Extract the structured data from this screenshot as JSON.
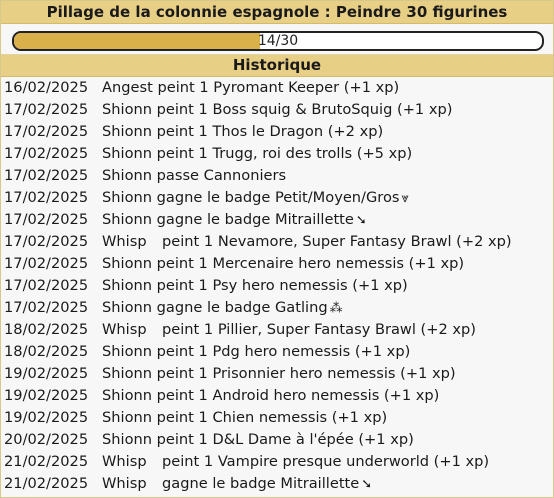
{
  "challenge": {
    "title": "Pillage de la colonnie espagnole : Peindre 30 figurines",
    "progress_text": "14/30",
    "progress_value": 14,
    "progress_total": 30,
    "accent_color": "#dab04a"
  },
  "history": {
    "title": "Historique",
    "entries": [
      {
        "date": "16/02/2025",
        "who": "Angest",
        "text": "peint 1 Pyromant Keeper (+1 xp)",
        "icon": ""
      },
      {
        "date": "17/02/2025",
        "who": "Shionn",
        "text": "peint 1 Boss squig & BrutoSquig (+1 xp)",
        "icon": ""
      },
      {
        "date": "17/02/2025",
        "who": "Shionn",
        "text": "peint 1 Thos le Dragon (+2 xp)",
        "icon": ""
      },
      {
        "date": "17/02/2025",
        "who": "Shionn",
        "text": "peint 1 Trugg, roi des trolls (+5 xp)",
        "icon": ""
      },
      {
        "date": "17/02/2025",
        "who": "Shionn",
        "text": "passe Cannoniers",
        "icon": ""
      },
      {
        "date": "17/02/2025",
        "who": "Shionn",
        "text": "gagne le badge Petit/Moyen/Gros",
        "icon": "⩔"
      },
      {
        "date": "17/02/2025",
        "who": "Shionn",
        "text": "gagne le badge Mitraillette",
        "icon": "➘"
      },
      {
        "date": "17/02/2025",
        "who": "Whisp",
        "text": "peint 1 Nevamore, Super Fantasy Brawl (+2 xp)",
        "icon": ""
      },
      {
        "date": "17/02/2025",
        "who": "Shionn",
        "text": "peint 1 Mercenaire hero nemessis (+1 xp)",
        "icon": ""
      },
      {
        "date": "17/02/2025",
        "who": "Shionn",
        "text": "peint 1 Psy hero nemessis (+1 xp)",
        "icon": ""
      },
      {
        "date": "17/02/2025",
        "who": "Shionn",
        "text": "gagne le badge Gatling",
        "icon": "⁂"
      },
      {
        "date": "18/02/2025",
        "who": "Whisp",
        "text": "peint 1 Pillier, Super Fantasy Brawl (+2 xp)",
        "icon": ""
      },
      {
        "date": "18/02/2025",
        "who": "Shionn",
        "text": "peint 1 Pdg hero nemessis (+1 xp)",
        "icon": ""
      },
      {
        "date": "19/02/2025",
        "who": "Shionn",
        "text": "peint 1 Prisonnier hero nemessis (+1 xp)",
        "icon": ""
      },
      {
        "date": "19/02/2025",
        "who": "Shionn",
        "text": "peint 1 Android hero nemessis (+1 xp)",
        "icon": ""
      },
      {
        "date": "19/02/2025",
        "who": "Shionn",
        "text": "peint 1 Chien nemessis (+1 xp)",
        "icon": ""
      },
      {
        "date": "20/02/2025",
        "who": "Shionn",
        "text": "peint 1 D&L Dame à l'épée (+1 xp)",
        "icon": ""
      },
      {
        "date": "21/02/2025",
        "who": "Whisp",
        "text": "peint 1 Vampire presque underworld (+1 xp)",
        "icon": ""
      },
      {
        "date": "21/02/2025",
        "who": "Whisp",
        "text": "gagne le badge Mitraillette",
        "icon": "➘"
      }
    ]
  }
}
